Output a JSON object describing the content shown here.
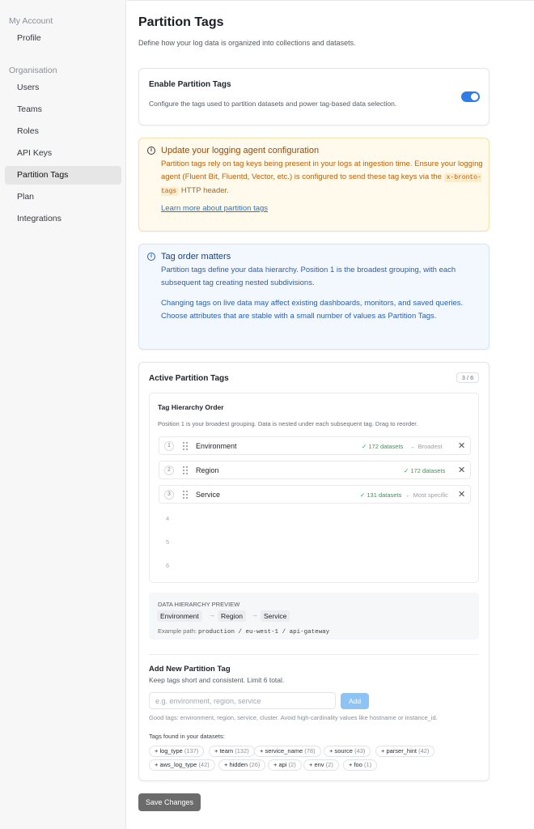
{
  "sidebar": {
    "section_account": "My Account",
    "profile": "Profile",
    "section_org": "Organisation",
    "items": [
      "Users",
      "Teams",
      "Roles",
      "API Keys",
      "Partition Tags",
      "Plan",
      "Integrations"
    ]
  },
  "page": {
    "title": "Partition Tags",
    "subtitle": "Define how your log data is organized into collections and datasets."
  },
  "enable": {
    "title": "Enable Partition Tags",
    "description": "Configure the tags used to partition datasets and power tag-based data selection.",
    "enabled": true
  },
  "warning": {
    "title": "Update your logging agent configuration",
    "body_part1": "Partition tags rely on tag keys being present in your logs at ingestion time. Ensure your logging agent (Fluent Bit, Fluentd, Vector, etc.) is configured to send these tag keys via the",
    "header_code": "x-bronto-tags",
    "body_part2": "HTTP header.",
    "link": "Learn more about partition tags"
  },
  "order_info": {
    "title": "Tag order matters",
    "para1": "Partition tags define your data hierarchy. Position 1 is the broadest grouping, with each subsequent tag creating nested subdivisions.",
    "para2": "Changing tags on live data may affect existing dashboards, monitors, and saved queries. Choose attributes that are stable with a small number of values as Partition Tags."
  },
  "active": {
    "title": "Active Partition Tags",
    "count": "3 / 6",
    "hierarchy_title": "Tag Hierarchy Order",
    "hierarchy_desc": "Position 1 is your broadest grouping. Data is nested under each subsequent tag. Drag to reorder.",
    "tags": [
      {
        "num": "1",
        "name": "Environment",
        "datasets": "✓ 172 datasets",
        "position": "← Broadest"
      },
      {
        "num": "2",
        "name": "Region",
        "datasets": "✓ 172 datasets",
        "position": ""
      },
      {
        "num": "3",
        "name": "Service",
        "datasets": "✓ 131 datasets",
        "position": "← Most specific"
      }
    ],
    "empty_slots": [
      "4",
      "5",
      "6"
    ]
  },
  "preview": {
    "label": "DATA HIERARCHY PREVIEW",
    "chain": [
      "Environment",
      "Region",
      "Service"
    ],
    "arrow": "→",
    "example_label": "Example path:",
    "example_path": "production / eu-west-1 / api-gateway"
  },
  "add_tag": {
    "title": "Add New Partition Tag",
    "hint": "Keep tags short and consistent. Limit 6 total.",
    "placeholder": "e.g. environment, region, service",
    "value": "",
    "add_label": "Add",
    "good_tags": "Good tags: environment, region, service, cluster. Avoid high-cardinality values like hostname or instance_id.",
    "found_label": "Tags found in your datasets:",
    "found": [
      {
        "name": "log_type",
        "count": "(137)"
      },
      {
        "name": "team",
        "count": "(132)"
      },
      {
        "name": "service_name",
        "count": "(78)"
      },
      {
        "name": "source",
        "count": "(43)"
      },
      {
        "name": "parser_hint",
        "count": "(42)"
      },
      {
        "name": "aws_log_type",
        "count": "(42)"
      },
      {
        "name": "hidden",
        "count": "(26)"
      },
      {
        "name": "api",
        "count": "(2)"
      },
      {
        "name": "env",
        "count": "(2)"
      },
      {
        "name": "foo",
        "count": "(1)"
      }
    ]
  },
  "save_label": "Save Changes",
  "colors": {
    "accent": "#2f7ee8",
    "warning_text": "#b8610b",
    "info_text": "#2b5fa8",
    "success": "#2ea04f"
  }
}
